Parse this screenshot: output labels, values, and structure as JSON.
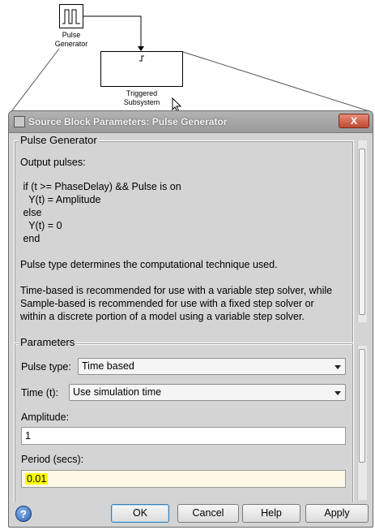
{
  "canvas": {
    "pulse_generator_label": "Pulse\nGenerator",
    "triggered_subsystem_label": "Triggered\nSubsystem"
  },
  "dialog": {
    "title": "Source Block Parameters: Pulse Generator",
    "close_label": "X",
    "description": {
      "group_title": "Pulse Generator",
      "intro": "Output pulses:",
      "code_lines": [
        " if (t >= PhaseDelay) && Pulse is on",
        "   Y(t) = Amplitude",
        " else",
        "   Y(t) = 0",
        " end"
      ],
      "note1": "Pulse type determines the computational technique used.",
      "note2_lines": [
        "Time-based is recommended for use with a variable step solver, while",
        "Sample-based is recommended for use with a fixed step solver or",
        "within a discrete portion of a model using a variable step solver."
      ]
    },
    "parameters": {
      "group_title": "Parameters",
      "pulse_type_label": "Pulse type:",
      "pulse_type_value": "Time based",
      "time_label": "Time (t):",
      "time_value": "Use simulation time",
      "amplitude_label": "Amplitude:",
      "amplitude_value": "1",
      "period_label": "Period (secs):",
      "period_value": "0.01"
    },
    "buttons": {
      "help_icon": "?",
      "ok": "OK",
      "cancel": "Cancel",
      "help": "Help",
      "apply": "Apply"
    }
  }
}
